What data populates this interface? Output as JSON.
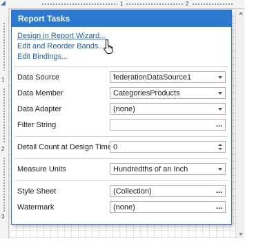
{
  "ruler": {
    "top_numbers": [
      "1",
      "2"
    ],
    "left_numbers": [
      "1",
      "2",
      "3"
    ]
  },
  "panel": {
    "title": "Report Tasks",
    "links": [
      {
        "label": "Design in Report Wizard..."
      },
      {
        "label": "Edit and Reorder Bands..."
      },
      {
        "label": "Edit Bindings..."
      }
    ],
    "data_source": {
      "label": "Data Source",
      "value": "federationDataSource1"
    },
    "data_member": {
      "label": "Data Member",
      "value": "CategoriesProducts"
    },
    "data_adapter": {
      "label": "Data Adapter",
      "value": "(none)"
    },
    "filter_string": {
      "label": "Filter String",
      "value": ""
    },
    "detail_count": {
      "label": "Detail Count at Design Time",
      "value": "0"
    },
    "measure_units": {
      "label": "Measure Units",
      "value": "Hundredths of an Inch"
    },
    "style_sheet": {
      "label": "Style Sheet",
      "value": "(Collection)"
    },
    "watermark": {
      "label": "Watermark",
      "value": "(none)"
    },
    "ellipsis": "..."
  },
  "colors": {
    "header": "#2b79d0",
    "link": "#1a5fb4",
    "border": "#2f6fbd"
  },
  "icons": {
    "cursor": "hand-pointer-icon"
  }
}
